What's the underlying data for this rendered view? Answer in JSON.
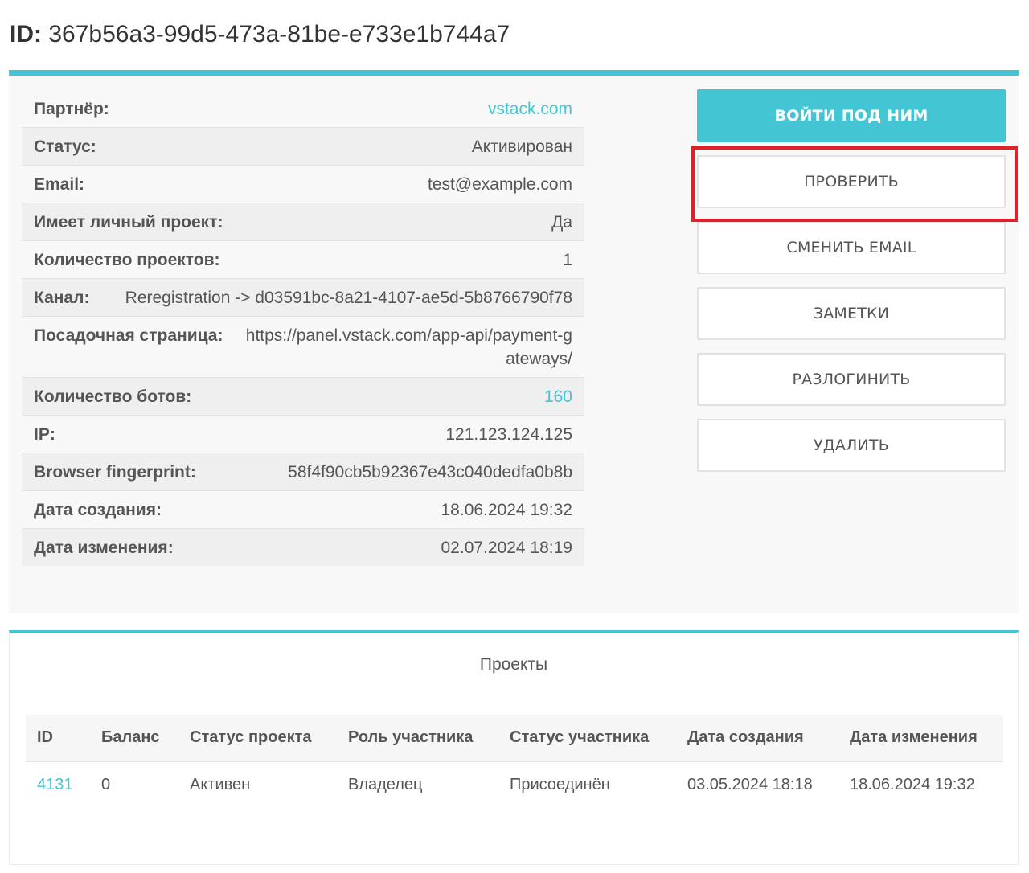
{
  "header": {
    "id_label": "ID:",
    "id_value": "367b56a3-99d5-473a-81be-e733e1b744a7"
  },
  "info": {
    "rows": [
      {
        "key": "Партнёр:",
        "value": "vstack.com",
        "link": true
      },
      {
        "key": "Статус:",
        "value": "Активирован"
      },
      {
        "key": "Email:",
        "value": "test@example.com"
      },
      {
        "key": "Имеет личный проект:",
        "value": "Да"
      },
      {
        "key": "Количество проектов:",
        "value": "1"
      },
      {
        "key": "Канал:",
        "value": "Reregistration -> d03591bc-8a21-4107-ae5d-5b8766790f78"
      },
      {
        "key": "Посадочная страница:",
        "value": "https://panel.vstack.com/app-api/payment-gateways/"
      },
      {
        "key": "Количество ботов:",
        "value": "160",
        "link": true
      },
      {
        "key": "IP:",
        "value": "121.123.124.125"
      },
      {
        "key": "Browser fingerprint:",
        "value": "58f4f90cb5b92367e43c040dedfa0b8b"
      },
      {
        "key": "Дата создания:",
        "value": "18.06.2024 19:32"
      },
      {
        "key": "Дата изменения:",
        "value": "02.07.2024 18:19"
      }
    ]
  },
  "actions": {
    "login_as": "ВОЙТИ ПОД НИМ",
    "verify": "ПРОВЕРИТЬ",
    "change_email": "СМЕНИТЬ EMAIL",
    "notes": "ЗАМЕТКИ",
    "logout": "РАЗЛОГИНИТЬ",
    "delete": "УДАЛИТЬ"
  },
  "projects": {
    "title": "Проекты",
    "columns": [
      "ID",
      "Баланс",
      "Статус проекта",
      "Роль участника",
      "Статус участника",
      "Дата создания",
      "Дата изменения"
    ],
    "rows": [
      [
        "4131",
        "0",
        "Активен",
        "Владелец",
        "Присоединён",
        "03.05.2024 18:18",
        "18.06.2024 19:32"
      ]
    ]
  },
  "colors": {
    "accent": "#44c5d4",
    "highlight": "#e0202a"
  }
}
